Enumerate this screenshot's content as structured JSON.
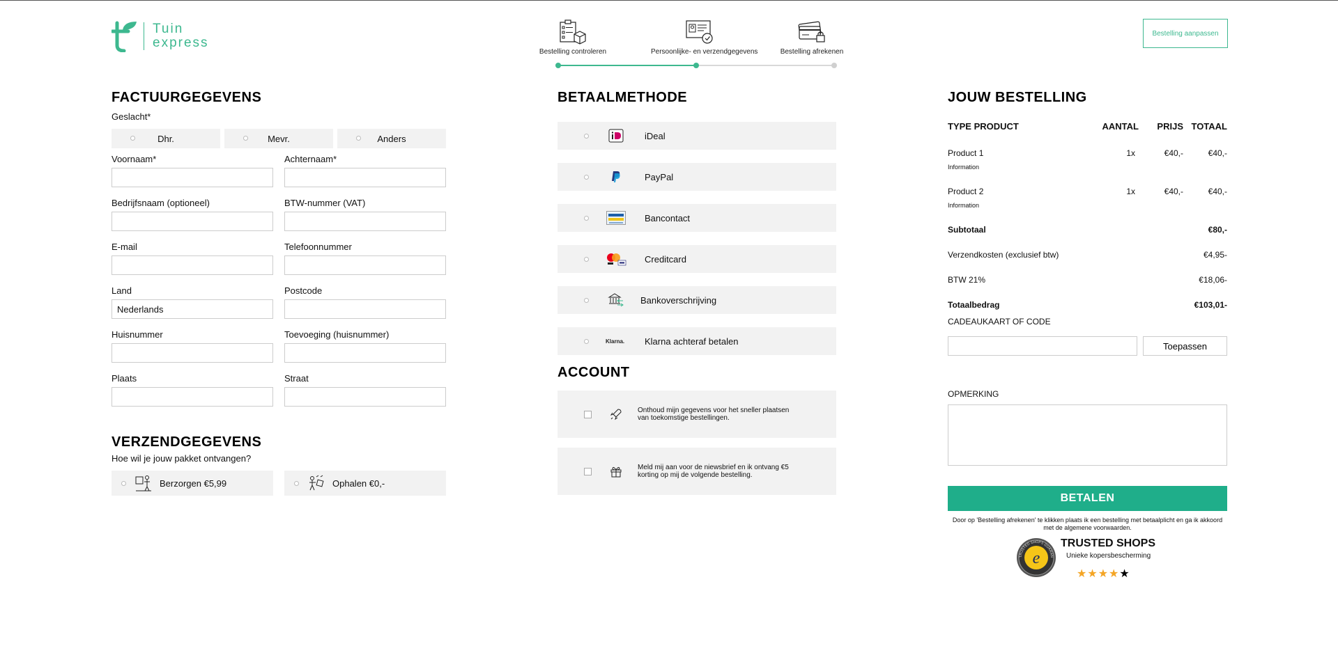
{
  "header": {
    "logo_line1": "Tuin",
    "logo_line2": "express",
    "steps": [
      {
        "label": "Bestelling controleren"
      },
      {
        "label": "Persoonlijke- en verzendgegevens"
      },
      {
        "label": "Bestelling afrekenen"
      }
    ],
    "current_step": 2,
    "edit_button": "Bestelling aanpassen"
  },
  "billing": {
    "title": "FACTUURGEGEVENS",
    "gender_label": "Geslacht*",
    "gender_options": [
      "Dhr.",
      "Mevr.",
      "Anders"
    ],
    "fields": [
      {
        "label": "Voornaam*",
        "value": ""
      },
      {
        "label": "Achternaam*",
        "value": ""
      },
      {
        "label": "Bedrijfsnaam (optioneel)",
        "value": ""
      },
      {
        "label": "BTW-nummer (VAT)",
        "value": ""
      },
      {
        "label": "E-mail",
        "value": ""
      },
      {
        "label": "Telefoonnummer",
        "value": ""
      },
      {
        "label": "Land",
        "value": "Nederlands"
      },
      {
        "label": "Postcode",
        "value": ""
      },
      {
        "label": "Huisnummer",
        "value": ""
      },
      {
        "label": "Toevoeging (huisnummer)",
        "value": ""
      },
      {
        "label": "Plaats",
        "value": ""
      },
      {
        "label": "Straat",
        "value": ""
      }
    ]
  },
  "shipping": {
    "title": "VERZENDGEGEVENS",
    "question": "Hoe wil je jouw pakket ontvangen?",
    "options": [
      {
        "label": "Berzorgen €5,99",
        "icon": "delivery-icon"
      },
      {
        "label": "Ophalen €0,-",
        "icon": "pickup-icon"
      }
    ]
  },
  "payment": {
    "title": "BETAALMETHODE",
    "methods": [
      {
        "label": "iDeal",
        "icon": "ideal-icon"
      },
      {
        "label": "PayPal",
        "icon": "paypal-icon"
      },
      {
        "label": "Bancontact",
        "icon": "bancontact-icon"
      },
      {
        "label": "Creditcard",
        "icon": "creditcard-icon"
      },
      {
        "label": "Bankoverschrijving",
        "icon": "bank-transfer-icon"
      },
      {
        "label": "Klarna achteraf betalen",
        "icon": "klarna-icon"
      }
    ]
  },
  "account": {
    "title": "ACCOUNT",
    "options": [
      {
        "text": "Onthoud mijn gegevens voor het sneller plaatsen van toekomstige bestellingen.",
        "icon": "rocket-icon"
      },
      {
        "text": "Meld mij aan voor de niewsbrief en ik ontvang €5 korting op mij de volgende bestelling.",
        "icon": "gift-icon"
      }
    ]
  },
  "order": {
    "title": "JOUW BESTELLING",
    "columns": [
      "TYPE PRODUCT",
      "AANTAL",
      "PRIJS",
      "TOTAAL"
    ],
    "items": [
      {
        "name": "Product 1",
        "info": "Information",
        "qty": "1x",
        "price": "€40,-",
        "total": "€40,-"
      },
      {
        "name": "Product 2",
        "info": "Information",
        "qty": "1x",
        "price": "€40,-",
        "total": "€40,-"
      }
    ],
    "subtotal_label": "Subtotaal",
    "subtotal_value": "€80,-",
    "shipping_label": "Verzendkosten (exclusief btw)",
    "shipping_value": "€4,95-",
    "vat_label": "BTW 21%",
    "vat_value": "€18,06-",
    "total_label": "Totaalbedrag",
    "total_value": "€103,01-",
    "code_label": "CADEAUKAART OF CODE",
    "code_value": "",
    "code_button": "Toepassen",
    "remark_label": "OPMERKING",
    "remark_value": "",
    "pay_button": "BETALEN",
    "terms": "Door op 'Bestelling afrekenen' te klikken plaats ik een bestelling met betaalplicht en ga ik akkoord met de algemene voorwaarden."
  },
  "trusted": {
    "title": "TRUSTED SHOPS",
    "subtitle": "Unieke kopersbescherming",
    "seal_letter": "e",
    "seal_ring": "TRUSTED SHOPS GUARANTEE",
    "rating": 4,
    "max_rating": 5
  },
  "colors": {
    "brand": "#3db88f",
    "pay_button": "#1fae8a",
    "option_bg": "#f2f2f2",
    "star": "#f4a525"
  }
}
